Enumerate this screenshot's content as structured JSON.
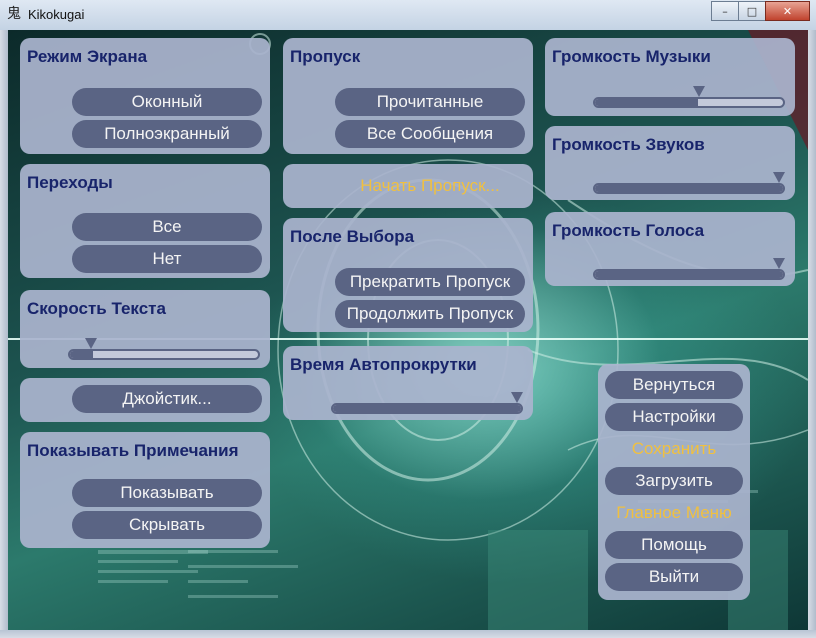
{
  "window": {
    "title": "Kikokugai",
    "icon": "app-kanji-icon",
    "controls": [
      "minimize-icon",
      "maximize-icon",
      "close-icon"
    ]
  },
  "colors": {
    "panel": "#aab4cd",
    "title_text": "#18246b",
    "button": "#5a6484",
    "button_text": "#f4f4f4",
    "highlight_text": "#f0c040"
  },
  "display_mode": {
    "title": "Режим Экрана",
    "windowed": "Оконный",
    "fullscreen": "Полноэкранный"
  },
  "transitions": {
    "title": "Переходы",
    "all": "Все",
    "none": "Нет"
  },
  "text_speed": {
    "title": "Скорость Текста",
    "value": 0.12
  },
  "joystick": {
    "label": "Джойстик..."
  },
  "show_notes": {
    "title": "Показывать Примечания",
    "show": "Показывать",
    "hide": "Скрывать"
  },
  "skip": {
    "title": "Пропуск",
    "read": "Прочитанные",
    "all": "Все Сообщения",
    "begin": "Начать Пропуск..."
  },
  "after_choice": {
    "title": "После Выбора",
    "stop": "Прекратить Пропуск",
    "continue": "Продолжить Пропуск"
  },
  "auto_forward": {
    "title": "Время Автопрокрутки",
    "value": 1.0
  },
  "music_volume": {
    "title": "Громкость Музыки",
    "value": 0.55
  },
  "sound_volume": {
    "title": "Громкость Звуков",
    "value": 1.0
  },
  "voice_volume": {
    "title": "Громкость Голоса",
    "value": 1.0
  },
  "nav_menu": {
    "return": "Вернуться",
    "preferences": "Настройки",
    "save": "Сохранить",
    "load": "Загрузить",
    "main_menu": "Главное Меню",
    "help": "Помощь",
    "quit": "Выйти"
  }
}
